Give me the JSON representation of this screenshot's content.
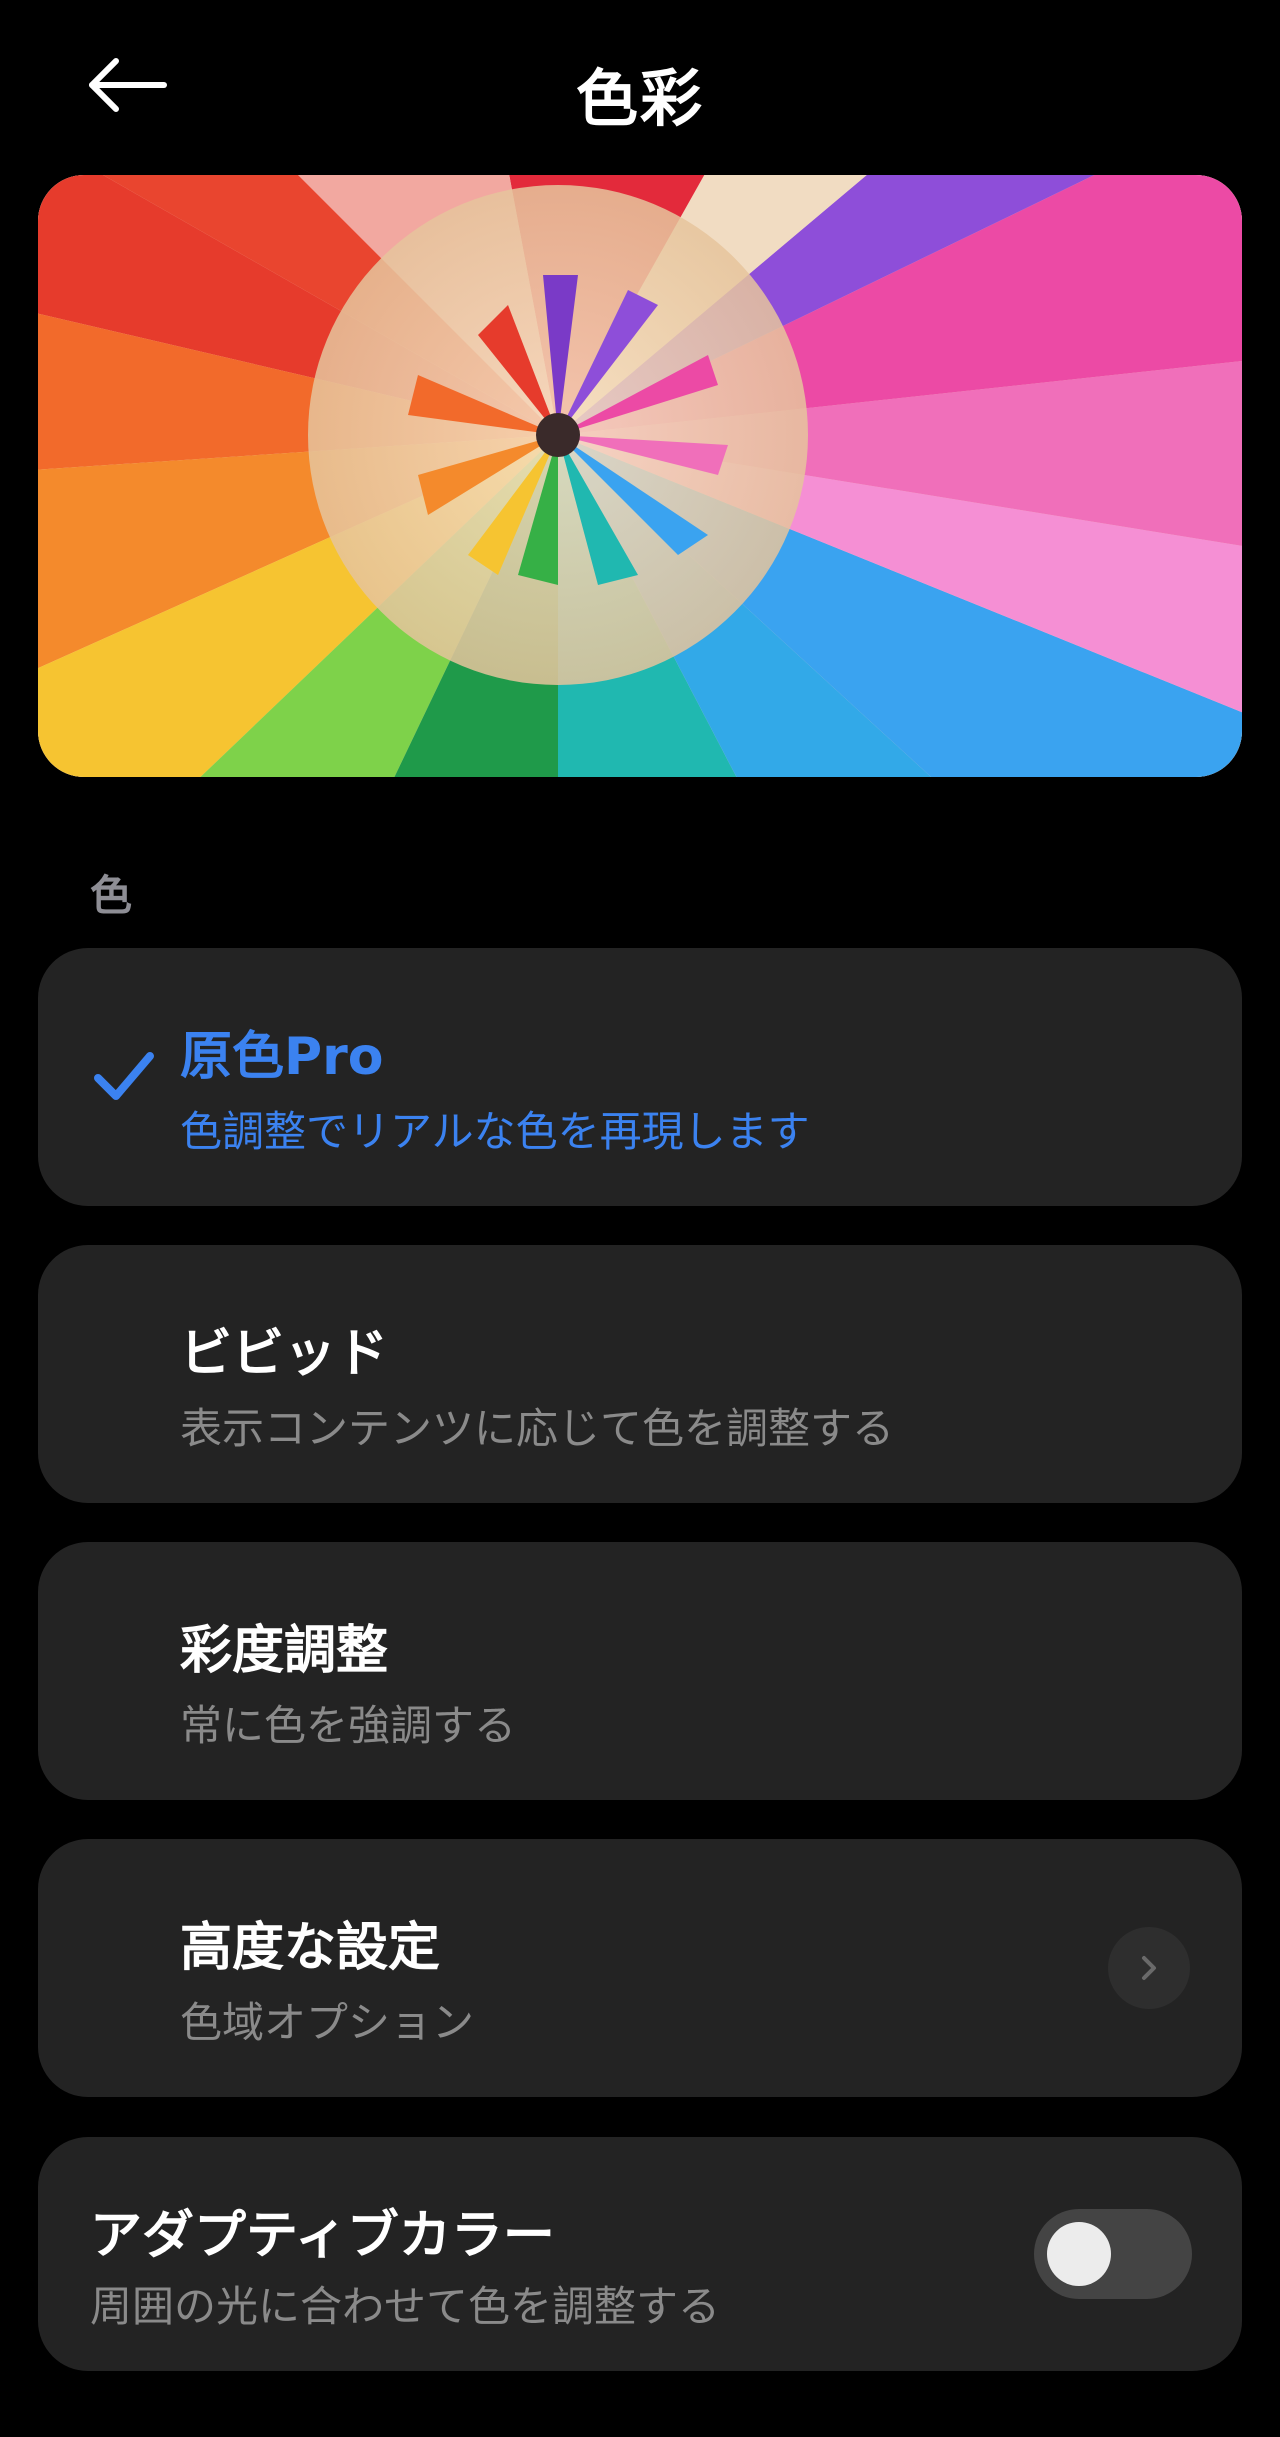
{
  "header": {
    "title": "色彩",
    "back_icon": "arrow-left-icon"
  },
  "hero": {
    "image": "colored-pencils-circle"
  },
  "section": {
    "label": "色"
  },
  "options": [
    {
      "title": "原色Pro",
      "subtitle": "色調整でリアルな色を再現します",
      "selected": true
    },
    {
      "title": "ビビッド",
      "subtitle": "表示コンテンツに応じて色を調整する",
      "selected": false
    },
    {
      "title": "彩度調整",
      "subtitle": "常に色を強調する",
      "selected": false
    }
  ],
  "advanced": {
    "title": "高度な設定",
    "subtitle": "色域オプション",
    "icon": "chevron-right-icon"
  },
  "adaptive": {
    "title": "アダプティブカラー",
    "subtitle": "周囲の光に合わせて色を調整する",
    "enabled": false
  },
  "colors": {
    "accent": "#3b82f0",
    "card": "#232323",
    "background": "#000000",
    "muted": "#8a8a8a"
  }
}
